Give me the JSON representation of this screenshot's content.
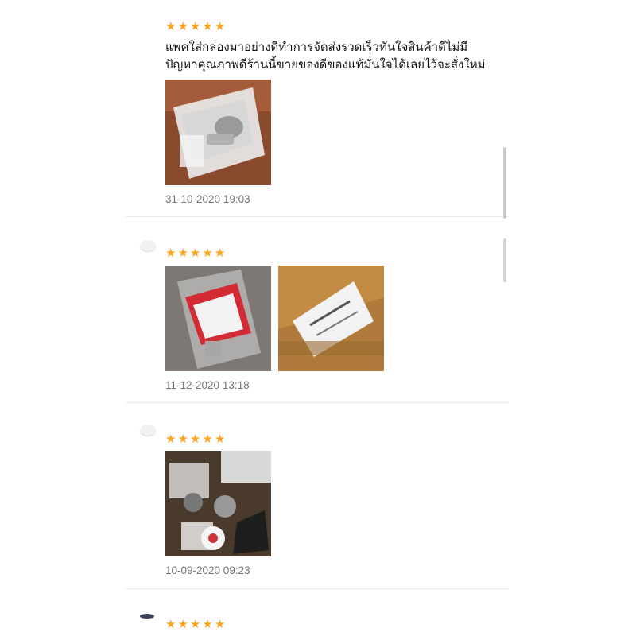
{
  "reviews": [
    {
      "rating": 5,
      "comment_lines": [
        "แพคใส่กล่องมาอย่างดีทำการจัดส่งรวดเร็วทันใจสินค้าดีไม่มี",
        "ปัญหาคุณภาพดีร้านนี้ขายของดีของแท้มั่นใจได้เลยไว้จะสั่งใหม่"
      ],
      "photos": [
        "bolt-in-bag-photo"
      ],
      "date": "31-10-2020 19:03"
    },
    {
      "rating": 5,
      "photos": [
        "honda-part-bag-photo",
        "parcel-box-photo"
      ],
      "date": "11-12-2020 13:18"
    },
    {
      "rating": 5,
      "photos": [
        "assorted-parts-photo"
      ],
      "date": "10-09-2020 09:23"
    },
    {
      "rating": 5
    }
  ],
  "icons": {
    "star": "star-icon",
    "avatar": "user-avatar"
  },
  "colors": {
    "star": "#f6a623",
    "date": "#757575",
    "divider": "#ececec"
  }
}
